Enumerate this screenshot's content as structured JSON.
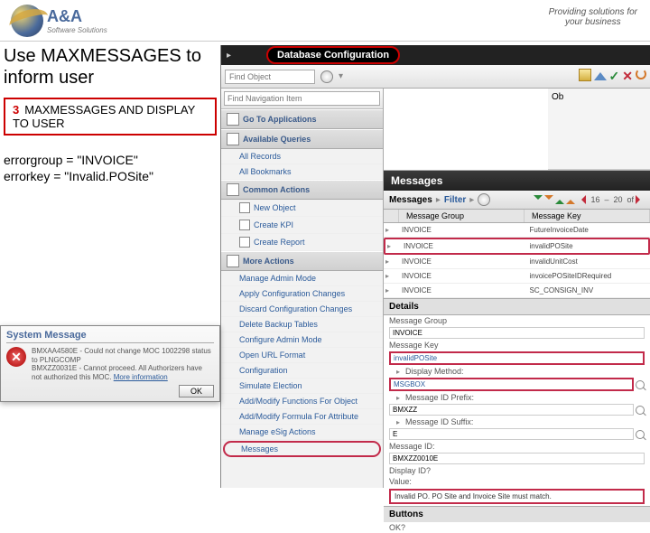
{
  "header": {
    "logo_main": "A&A",
    "logo_sub": "Software Solutions",
    "tagline": "Providing solutions for\nyour business"
  },
  "slide": {
    "title": "Use MAXMESSAGES to inform user",
    "step_num": "3",
    "step_text": "MAXMESSAGES AND DISPLAY TO USER",
    "code_line1": "errorgroup = \"INVOICE\"",
    "code_line2": "errorkey = \"Invalid.POSite\""
  },
  "app": {
    "section_title": "Database Configuration",
    "find_object_placeholder": "Find Object",
    "find_nav_placeholder": "Find Navigation Item",
    "ob_label": "Ob",
    "nav": {
      "go_to": "Go To Applications",
      "available_queries": "Available Queries",
      "all_records": "All Records",
      "all_bookmarks": "All Bookmarks",
      "common_actions": "Common Actions",
      "new_object": "New Object",
      "create_kpi": "Create KPI",
      "create_report": "Create Report",
      "more_actions": "More Actions",
      "manage_admin": "Manage Admin Mode",
      "apply_config": "Apply Configuration Changes",
      "discard_config": "Discard Configuration Changes",
      "reload_db": "Delete Backup Tables",
      "reload_cache": "Configure Admin Mode",
      "reload_url": "Open URL Format",
      "reload_text": "Configuration",
      "reload_import": "Simulate Election",
      "add_modify": "Add/Modify Functions For Object",
      "add_modify2": "Add/Modify Formula For Attribute",
      "manage_esig": "Manage eSig Actions",
      "messages": "Messages"
    },
    "messages_panel": {
      "title": "Messages",
      "header": "Messages",
      "filter": "Filter",
      "pager_from": "16",
      "pager_to": "20",
      "col1": "Message Group",
      "col2": "Message Key",
      "rows": [
        {
          "g": "INVOICE",
          "k": "FutureInvoiceDate"
        },
        {
          "g": "INVOICE",
          "k": "invalidPOSite"
        },
        {
          "g": "INVOICE",
          "k": "invalidUnitCost"
        },
        {
          "g": "INVOICE",
          "k": "invoicePOSiteIDRequired"
        },
        {
          "g": "INVOICE",
          "k": "SC_CONSIGN_INV"
        }
      ],
      "details": "Details",
      "d_msggroup": "Message Group",
      "d_msggroup_v": "INVOICE",
      "d_msgkey": "Message Key",
      "d_msgkey_v": "invalidPOSite",
      "d_display": "Display Method:",
      "d_display_v": "MSGBOX",
      "d_prefix": "Message ID Prefix:",
      "d_prefix_v": "BMXZZ",
      "d_suffix": "Message ID Suffix:",
      "d_suffix_v": "E",
      "d_msgid": "Message ID:",
      "d_msgid_v": "BMXZZ0010E",
      "d_display_id": "Display ID?",
      "d_value": "Value:",
      "d_value_v": "Invalid PO. PO Site and Invoice Site must match.",
      "buttons_h": "Buttons",
      "d_ok": "OK?"
    }
  },
  "sysmsg": {
    "title": "System Message",
    "line1": "BMXAA4580E - Could not change MOC 1002298 status to PLNGCOMP",
    "line2": "BMXZZ0031E - Cannot proceed. All Authorizers have not authorized this MOC.",
    "more": "More information",
    "ok": "OK"
  }
}
